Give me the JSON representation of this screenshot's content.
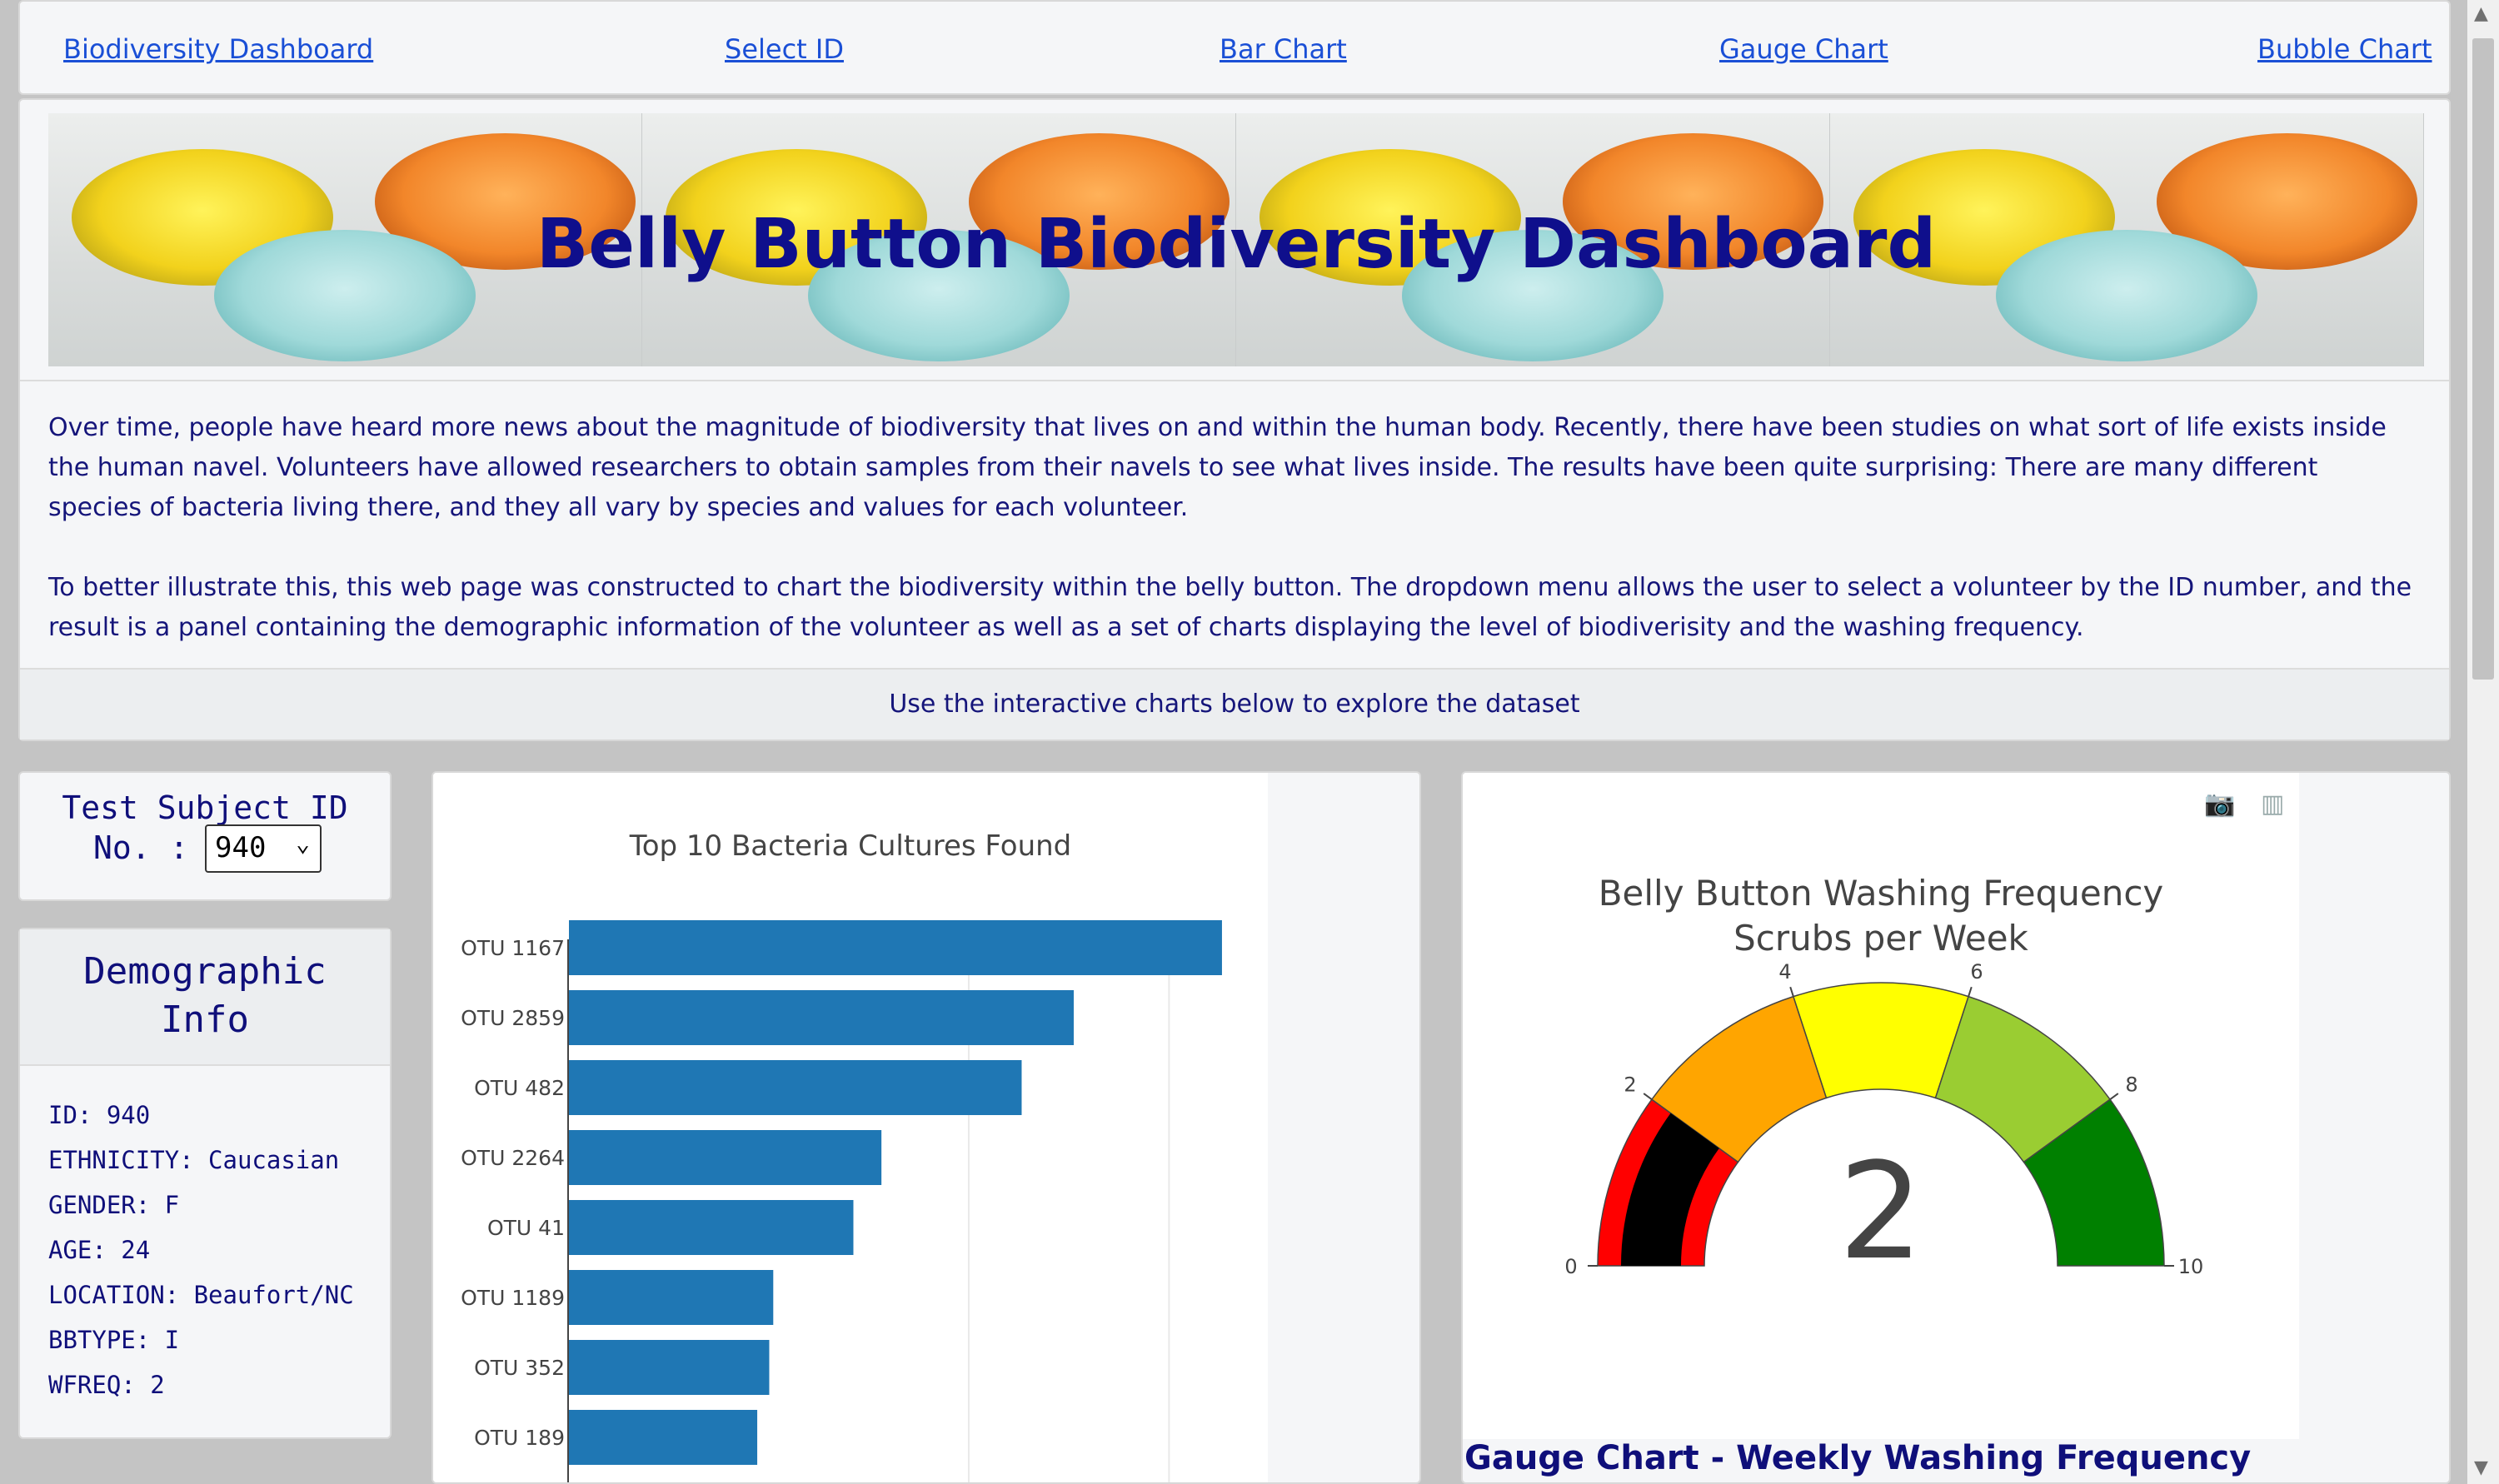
{
  "nav": {
    "items": [
      "Biodiversity Dashboard",
      "Select ID",
      "Bar Chart",
      "Gauge Chart",
      "Bubble Chart"
    ]
  },
  "hero": {
    "title": "Belly Button Biodiversity Dashboard",
    "paragraph1": "Over time, people have heard more news about the magnitude of biodiversity that lives on and within the human body. Recently, there have been studies on what sort of life exists inside the human navel. Volunteers have allowed researchers to obtain samples from their navels to see what lives inside. The results have been quite surprising: There are many different species of bacteria living there, and they all vary by species and values for each volunteer.",
    "paragraph2": "To better illustrate this, this web page was constructed to chart the biodiversity within the belly button. The dropdown menu allows the user to select a volunteer by the ID number, and the result is a panel containing the demographic information of the volunteer as well as a set of charts displaying the level of biodiverisity and the washing frequency.",
    "footer": "Use the interactive charts below to explore the dataset"
  },
  "selector": {
    "label_line1": "Test Subject ID",
    "label_line2": "No. :",
    "selected": "940"
  },
  "demographics": {
    "title": "Demographic Info",
    "rows": [
      "ID: 940",
      "ETHNICITY: Caucasian",
      "GENDER: F",
      "AGE: 24",
      "LOCATION: Beaufort/NC",
      "BBTYPE: I",
      "WFREQ: 2"
    ]
  },
  "chart_data": [
    {
      "type": "bar",
      "orientation": "horizontal",
      "title": "Top 10 Bacteria Cultures Found",
      "categories": [
        "OTU 1167",
        "OTU 2859",
        "OTU 482",
        "OTU 2264",
        "OTU 41",
        "OTU 1189",
        "OTU 352",
        "OTU 189"
      ],
      "values": [
        163,
        126,
        113,
        78,
        71,
        51,
        50,
        47
      ],
      "xlim": [
        0,
        210
      ],
      "bar_color": "#1f77b4",
      "grid": true
    },
    {
      "type": "gauge",
      "title_line1": "Belly Button Washing Frequency",
      "title_line2": "Scrubs per Week",
      "value": 2,
      "range": [
        0,
        10
      ],
      "ticks": [
        0,
        2,
        4,
        6,
        8,
        10
      ],
      "bands": [
        {
          "from": 0,
          "to": 2,
          "color": "#ff0000"
        },
        {
          "from": 2,
          "to": 4,
          "color": "#ffa500"
        },
        {
          "from": 4,
          "to": 6,
          "color": "#ffff00"
        },
        {
          "from": 6,
          "to": 8,
          "color": "#9acd32"
        },
        {
          "from": 8,
          "to": 10,
          "color": "#008000"
        }
      ],
      "bar_color": "#000000"
    }
  ],
  "gauge_caption": "Gauge Chart - Weekly Washing Frequency",
  "modebar": {
    "camera_icon": "📷",
    "plotly_icon": "▥"
  }
}
